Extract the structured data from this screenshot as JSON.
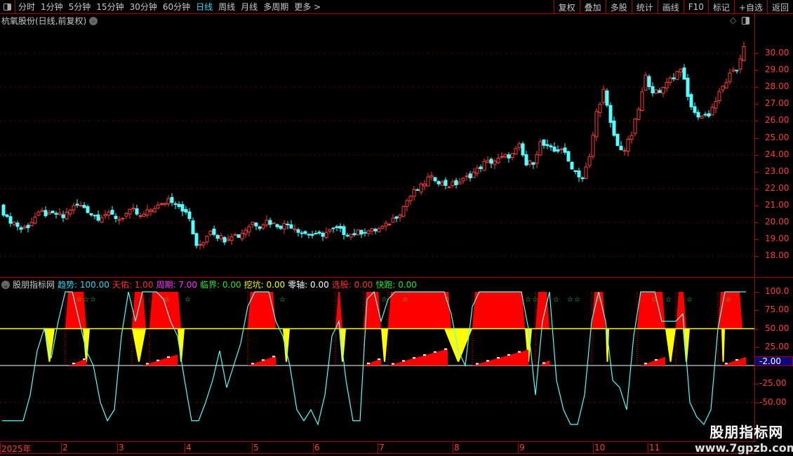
{
  "toolbar": {
    "periods": [
      "分时",
      "1分钟",
      "5分钟",
      "15分钟",
      "30分钟",
      "60分钟",
      "日线",
      "周线",
      "月线",
      "多周期",
      "更多 >"
    ],
    "active_period": "日线",
    "buttons": [
      "复权",
      "叠加",
      "多股",
      "统计",
      "画线",
      "F10",
      "标记",
      "+自选",
      "返回"
    ]
  },
  "chart_title": "杭氧股份(日线,前复权)",
  "price_axis": {
    "labels": [
      "30.00",
      "29.00",
      "28.00",
      "27.00",
      "26.00",
      "25.00",
      "24.00",
      "23.00",
      "22.00",
      "21.00",
      "20.00",
      "19.00",
      "18.00"
    ]
  },
  "indicator": {
    "name": "股朋指标网",
    "legend": [
      {
        "label": "趋势: 100.00",
        "color": "#39d3f2"
      },
      {
        "label": "天佑: 1.00",
        "color": "#ff3030"
      },
      {
        "label": "周期: 7.00",
        "color": "#ff30ff"
      },
      {
        "label": "临界: 0.00",
        "color": "#30e030"
      },
      {
        "label": "挖坑: 0.00",
        "color": "#ffff00"
      },
      {
        "label": "零轴: 0.00",
        "color": "#ffffff"
      },
      {
        "label": "选股: 0.00",
        "color": "#ff3030"
      },
      {
        "label": "快跑: 0.00",
        "color": "#30e030"
      }
    ],
    "axis_labels": [
      "100.0",
      "75.00",
      "50.00",
      "25.00",
      "-25.00",
      "-50.00"
    ],
    "current_badge": "-2.00"
  },
  "time_axis": [
    "2025年",
    "2",
    "3",
    "4",
    "5",
    "6",
    "7",
    "8",
    "9",
    "10",
    "11"
  ],
  "watermark": {
    "line1": "股朋指标网",
    "line2": "www.7gpzb.com"
  },
  "chart_data": {
    "type": "candlestick",
    "ylim": [
      17.5,
      31.5
    ],
    "closes_every_2_days": [
      21.0,
      20.2,
      20.0,
      19.6,
      19.8,
      20.3,
      20.6,
      20.4,
      20.5,
      20.3,
      20.8,
      21.0,
      20.9,
      20.5,
      20.3,
      20.5,
      20.4,
      20.2,
      20.5,
      20.7,
      20.3,
      20.6,
      20.9,
      21.0,
      21.4,
      21.2,
      20.8,
      20.2,
      18.5,
      18.9,
      19.6,
      19.2,
      19.0,
      19.3,
      19.2,
      19.6,
      20.0,
      19.8,
      20.1,
      19.9,
      19.8,
      19.9,
      19.7,
      19.4,
      19.3,
      19.2,
      19.3,
      19.5,
      19.6,
      19.4,
      19.3,
      19.4,
      19.5,
      19.5,
      19.6,
      19.8,
      20.2,
      20.6,
      21.3,
      21.8,
      22.1,
      22.6,
      22.6,
      22.3,
      22.2,
      22.3,
      22.5,
      22.8,
      23.1,
      23.5,
      23.6,
      23.7,
      23.9,
      24.0,
      24.5,
      23.4,
      23.6,
      24.7,
      24.4,
      24.2,
      24.4,
      23.6,
      23.0,
      22.6,
      23.8,
      26.5,
      27.8,
      25.8,
      24.5,
      24.3,
      25.2,
      26.7,
      28.6,
      27.8,
      27.6,
      28.4,
      28.6,
      29.2,
      27.4,
      26.4,
      26.3,
      26.4,
      27.2,
      28.0,
      28.7,
      29.0,
      30.5
    ],
    "indicator": {
      "ylim": [
        -80,
        100
      ],
      "trend_every_2_days": [
        -75,
        -75,
        -75,
        -75,
        -40,
        20,
        50,
        10,
        60,
        100,
        100,
        60,
        20,
        0,
        -50,
        -75,
        -60,
        40,
        100,
        60,
        100,
        100,
        100,
        90,
        60,
        40,
        -20,
        -75,
        -75,
        -50,
        -20,
        20,
        -30,
        0,
        30,
        80,
        100,
        100,
        100,
        60,
        40,
        0,
        -60,
        -75,
        -60,
        -80,
        -40,
        40,
        60,
        -20,
        -75,
        -75,
        90,
        100,
        60,
        90,
        100,
        100,
        100,
        100,
        100,
        100,
        100,
        100,
        70,
        20,
        0,
        80,
        100,
        100,
        100,
        100,
        100,
        100,
        100,
        50,
        -40,
        60,
        100,
        -20,
        -60,
        -80,
        -80,
        -40,
        60,
        100,
        60,
        -20,
        -30,
        -60,
        40,
        100,
        100,
        100,
        60,
        60,
        60,
        70,
        -50,
        -70,
        -80,
        -60,
        50,
        100,
        100,
        100,
        100
      ],
      "red_zones": [
        [
          18,
          24
        ],
        [
          37,
          41
        ],
        [
          42,
          51
        ],
        [
          70,
          78
        ],
        [
          95,
          97
        ],
        [
          103,
          108
        ],
        [
          110,
          128
        ],
        [
          134,
          149
        ],
        [
          152,
          156
        ],
        [
          168,
          172
        ],
        [
          181,
          189
        ],
        [
          192,
          195
        ],
        [
          204,
          211
        ]
      ],
      "yellow_zones": [
        [
          12,
          15
        ],
        [
          23,
          25
        ],
        [
          37,
          41
        ],
        [
          50,
          52
        ],
        [
          80,
          82
        ],
        [
          96,
          98
        ],
        [
          108,
          110
        ],
        [
          126,
          134
        ],
        [
          149,
          151
        ],
        [
          172,
          173
        ],
        [
          189,
          192
        ],
        [
          194,
          196
        ],
        [
          205,
          206
        ]
      ],
      "ramps": [
        [
          19,
          24
        ],
        [
          40,
          50
        ],
        [
          70,
          78
        ],
        [
          103,
          108
        ],
        [
          110,
          127
        ],
        [
          134,
          150
        ],
        [
          153,
          156
        ],
        [
          182,
          189
        ],
        [
          205,
          212
        ]
      ],
      "stars": [
        21,
        23,
        25,
        46,
        52,
        79,
        108,
        114,
        126,
        149,
        151,
        157,
        161,
        163,
        169,
        185,
        189,
        195,
        206
      ]
    }
  },
  "colors": {
    "up": "#ff3c3c",
    "down": "#54ffff",
    "grid": "#b00000",
    "yellow": "#ffff00",
    "red": "#ff0000"
  }
}
